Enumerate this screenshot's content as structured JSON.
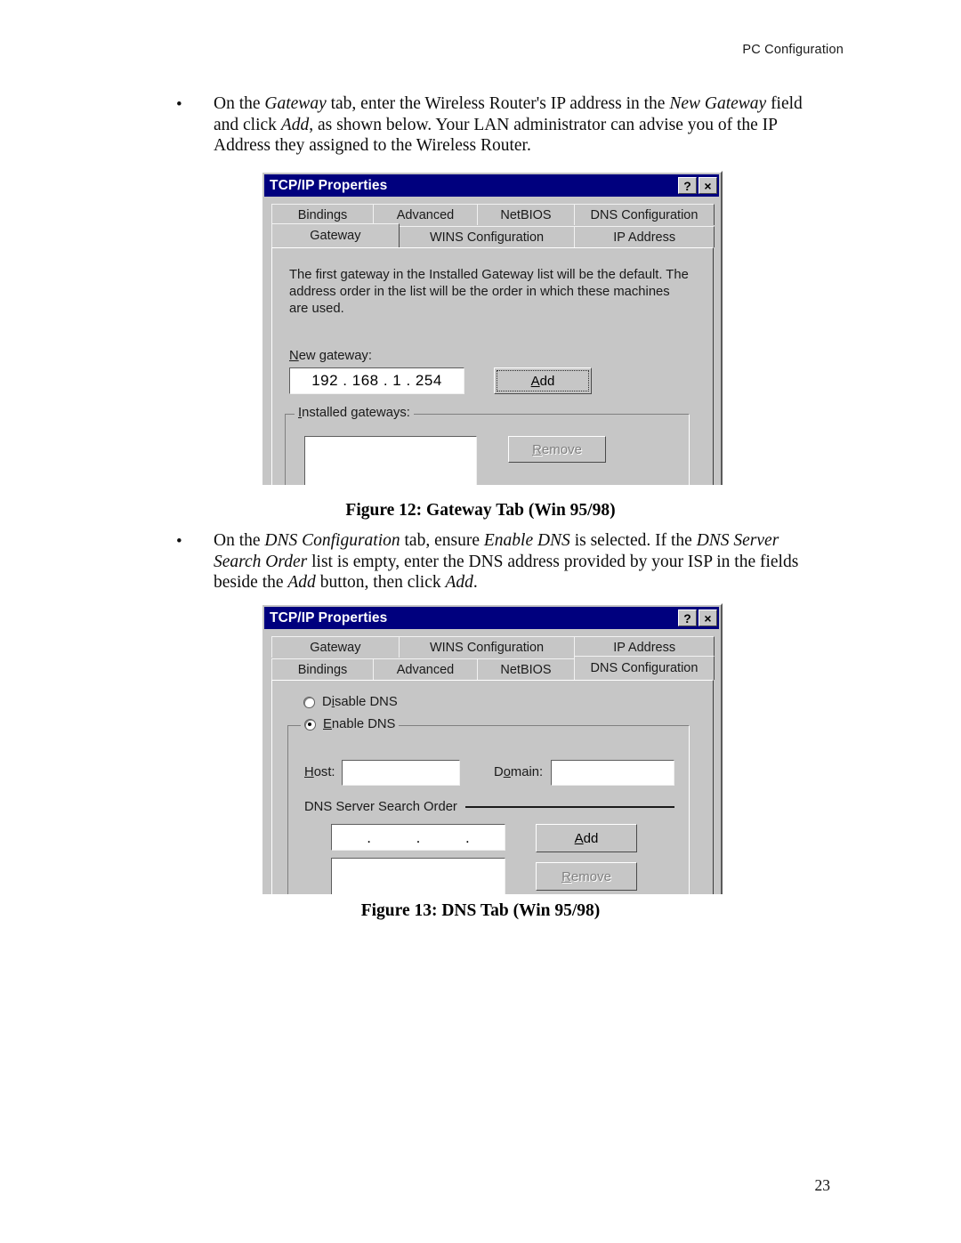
{
  "header": {
    "running_head": "PC Configuration"
  },
  "page_number": "23",
  "bullets": [
    {
      "marker": "•",
      "segments": [
        {
          "text": "On the ",
          "italic": false
        },
        {
          "text": "Gateway",
          "italic": true
        },
        {
          "text": " tab, enter the Wireless Router's IP address in the ",
          "italic": false
        },
        {
          "text": "New Gateway",
          "italic": true
        },
        {
          "text": " field and click ",
          "italic": false
        },
        {
          "text": "Add",
          "italic": true
        },
        {
          "text": ", as shown below. Your LAN administrator can advise you of the IP Address they assigned to the Wireless Router.",
          "italic": false
        }
      ]
    },
    {
      "marker": "•",
      "segments": [
        {
          "text": "On the ",
          "italic": false
        },
        {
          "text": "DNS Configuration",
          "italic": true
        },
        {
          "text": " tab, ensure ",
          "italic": false
        },
        {
          "text": "Enable DNS",
          "italic": true
        },
        {
          "text": " is selected. If the ",
          "italic": false
        },
        {
          "text": "DNS Server Search Order",
          "italic": true
        },
        {
          "text": " list is empty, enter the DNS address provided by your ISP in the fields beside the ",
          "italic": false
        },
        {
          "text": "Add",
          "italic": true
        },
        {
          "text": " button, then click ",
          "italic": false
        },
        {
          "text": "Add",
          "italic": true
        },
        {
          "text": ".",
          "italic": false
        }
      ]
    }
  ],
  "captions": {
    "figure_12": "Figure 12: Gateway Tab (Win 95/98)",
    "figure_13": "Figure 13: DNS Tab (Win 95/98)"
  },
  "colors": {
    "titlebar": "#00007e",
    "dialog_face": "#c6c6c6",
    "annotation_red": "#ee0000"
  },
  "dialog_gateway": {
    "title": "TCP/IP Properties",
    "help_button": "?",
    "close_button": "×",
    "tabs_row1": [
      "Bindings",
      "Advanced",
      "NetBIOS",
      "DNS Configuration"
    ],
    "tabs_row2": [
      "Gateway",
      "WINS Configuration",
      "IP Address"
    ],
    "active_tab": "Gateway",
    "helper_text": "The first gateway in the Installed Gateway list will be the default. The address order in the list will be the order in which these machines are used.",
    "new_gateway_label": "New gateway:",
    "new_gateway_value": "192 . 168 . 1 . 254",
    "add_button": "Add",
    "installed_gateways_label": "Installed gateways:",
    "installed_gateways_items": [],
    "remove_button": "Remove",
    "remove_disabled": true
  },
  "dialog_dns": {
    "title": "TCP/IP Properties",
    "help_button": "?",
    "close_button": "×",
    "tabs_row1": [
      "Gateway",
      "WINS Configuration",
      "IP Address"
    ],
    "tabs_row2": [
      "Bindings",
      "Advanced",
      "NetBIOS",
      "DNS Configuration"
    ],
    "active_tab": "DNS Configuration",
    "disable_dns_label": "Disable DNS",
    "enable_dns_label": "Enable DNS",
    "dns_selection": "Enable DNS",
    "host_label": "Host:",
    "host_value": "",
    "domain_label": "Domain:",
    "domain_value": "",
    "search_order_label": "DNS Server Search Order",
    "search_order_input_value": "   .      .      .   ",
    "search_order_items": [],
    "add_button": "Add",
    "remove_button": "Remove",
    "remove_disabled": true,
    "annotation": "red-ellipse-highlight"
  }
}
